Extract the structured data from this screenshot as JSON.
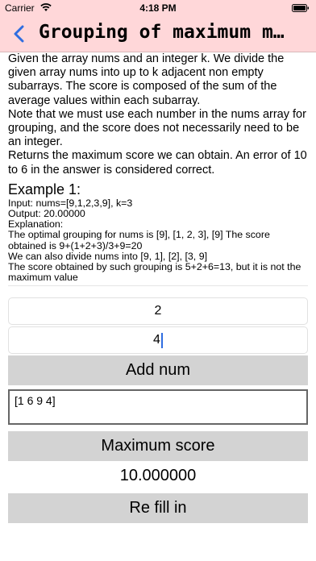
{
  "status_bar": {
    "carrier": "Carrier",
    "time": "4:18 PM"
  },
  "nav": {
    "title": "Grouping of maximum m…"
  },
  "problem": {
    "description": "Given the array nums and an integer k. We divide the given array nums into up to k adjacent non empty subarrays. The score is composed of the sum of the average values within each subarray.\nNote that we must use each number in the nums array for grouping, and the score does not necessarily need to be an integer.\nReturns the maximum score we can obtain. An error of 10 to 6 in the answer is considered correct.",
    "example_title": "Example 1:",
    "example_body": "Input: nums=[9,1,2,3,9], k=3\nOutput: 20.00000\nExplanation:\nThe optimal grouping for nums is [9], [1, 2, 3], [9] The score obtained is 9+(1+2+3)/3+9=20\nWe can also divide nums into [9, 1], [2], [3, 9]\nThe score obtained by such grouping is 5+2+6=13, but it is not the maximum value"
  },
  "inputs": {
    "k_value": "2",
    "num_value": "4"
  },
  "buttons": {
    "add_num": "Add num",
    "maximum_score": "Maximum score",
    "refill": "Re fill in"
  },
  "array_display": "[1 6 9 4]",
  "result": "10.000000"
}
